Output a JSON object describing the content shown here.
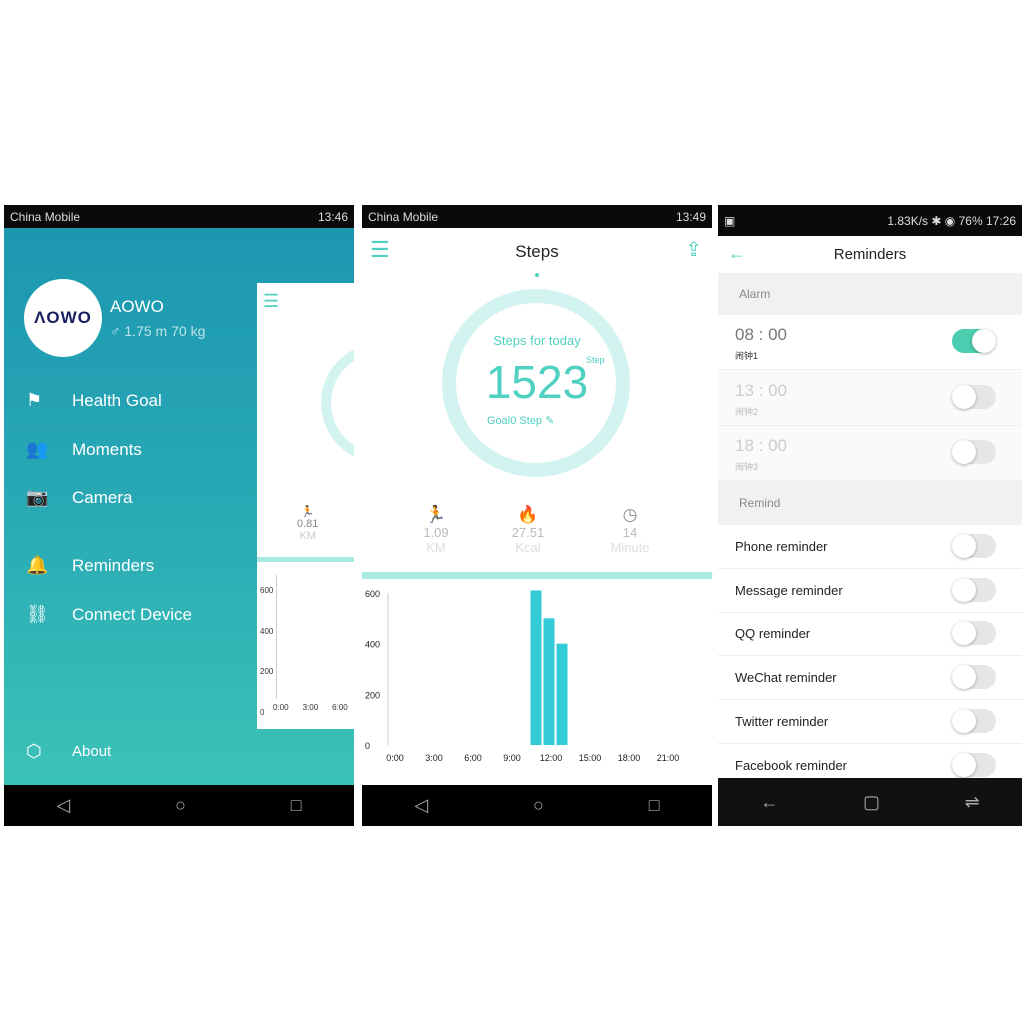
{
  "screen1": {
    "status": {
      "carrier": "China Mobile",
      "time": "13:46"
    },
    "user": {
      "logo": "AOWO",
      "name": "AOWO",
      "height": "1.75",
      "height_unit": "m",
      "weight": "70",
      "weight_unit": "kg"
    },
    "menu": [
      {
        "label": "Health Goal",
        "icon": "flag-icon"
      },
      {
        "label": "Moments",
        "icon": "people-icon"
      },
      {
        "label": "Camera",
        "icon": "camera-icon"
      },
      {
        "label": "Reminders",
        "icon": "bell-icon"
      },
      {
        "label": "Connect Device",
        "icon": "link-icon"
      }
    ],
    "about": "About",
    "peek": {
      "km": "0.81",
      "km_unit": "KM",
      "y_ticks": [
        "600",
        "400",
        "200",
        "0"
      ],
      "x_ticks": [
        "0:00",
        "3:00",
        "6:00"
      ]
    }
  },
  "screen2": {
    "status": {
      "carrier": "China Mobile",
      "time": "13:49"
    },
    "title": "Steps",
    "steps_label": "Steps for today",
    "steps": "1523",
    "steps_unit": "Step",
    "goal": "Goal0 Step",
    "stats": [
      {
        "value": "1.09",
        "unit": "KM",
        "icon": "running-icon"
      },
      {
        "value": "27.51",
        "unit": "Kcal",
        "icon": "flame-icon"
      },
      {
        "value": "14",
        "unit": "Minute",
        "icon": "clock-icon"
      }
    ],
    "accent": "#4fd0c0"
  },
  "chart_data": {
    "type": "bar",
    "x_ticks": [
      "0:00",
      "3:00",
      "6:00",
      "9:00",
      "12:00",
      "15:00",
      "18:00",
      "21:00"
    ],
    "y_ticks": [
      "600",
      "400",
      "200",
      "0"
    ],
    "ylim": [
      0,
      600
    ],
    "categories": [
      "11:00",
      "12:00",
      "13:00"
    ],
    "values": [
      610,
      500,
      400
    ],
    "bar_color": "#33cbd8"
  },
  "screen3": {
    "status": {
      "speed": "1.83K/s",
      "battery": "76%",
      "time": "17:26"
    },
    "title": "Reminders",
    "alarm_header": "Alarm",
    "alarms": [
      {
        "time": "08 : 00",
        "label": "闹钟1",
        "on": true
      },
      {
        "time": "13 : 00",
        "label": "闹钟2",
        "on": false
      },
      {
        "time": "18 : 00",
        "label": "闹钟3",
        "on": false
      }
    ],
    "remind_header": "Remind",
    "reminders": [
      "Phone reminder",
      "Message reminder",
      "QQ reminder",
      "WeChat reminder",
      "Twitter reminder",
      "Facebook reminder"
    ]
  }
}
